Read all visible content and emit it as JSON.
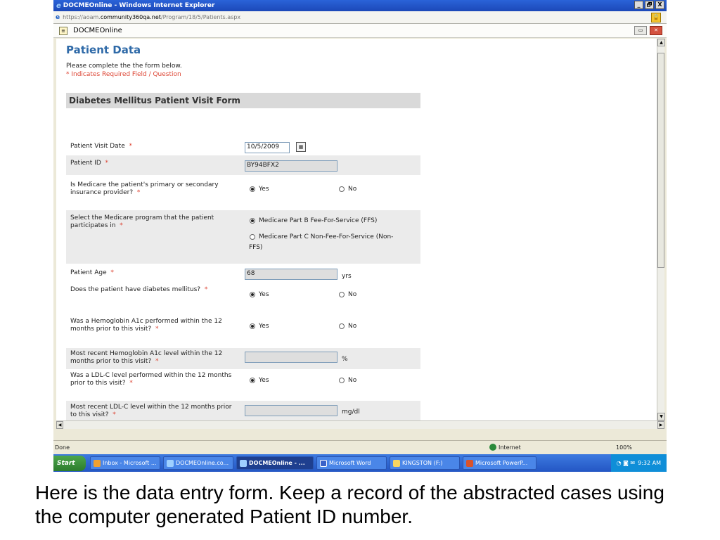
{
  "window": {
    "title": "DOCMEOnline - Windows Internet Explorer",
    "url_prefix": "https://",
    "url_host_sub": "aoam.",
    "url_host": "community360qa.net",
    "url_path": "/Program/18/5/Patients.aspx",
    "tab_title": "DOCMEOnline",
    "controls": {
      "minimize": "_",
      "maximize": "🗗",
      "close": "X"
    }
  },
  "page": {
    "title": "Patient Data",
    "intro_line": "Please complete the the form below.",
    "required_note": "* Indicates Required Field / Question",
    "form_title": "Diabetes Mellitus Patient Visit Form"
  },
  "form": {
    "visit_date": {
      "label": "Patient Visit Date",
      "value": "10/5/2009"
    },
    "patient_id": {
      "label": "Patient ID",
      "value": "BY94BFX2"
    },
    "medicare": {
      "label": "Is Medicare the patient's primary or secondary insurance provider?",
      "yes": "Yes",
      "no": "No"
    },
    "program": {
      "label": "Select the Medicare program that the patient participates in",
      "opt1": "Medicare Part B Fee-For-Service (FFS)",
      "opt2": "Medicare Part C Non-Fee-For-Service (Non-FFS)"
    },
    "age": {
      "label": "Patient Age",
      "value": "68",
      "unit": "yrs"
    },
    "diabetes": {
      "label": "Does the patient have diabetes mellitus?",
      "yes": "Yes",
      "no": "No"
    },
    "a1c_performed": {
      "label": "Was a Hemoglobin A1c performed within the 12 months prior to this visit?",
      "yes": "Yes",
      "no": "No"
    },
    "a1c_level": {
      "label": "Most recent Hemoglobin A1c level within the 12 months prior to this visit?",
      "value": "",
      "unit": "%"
    },
    "ldl_performed": {
      "label": "Was a LDL-C level performed within the 12 months prior to this visit?",
      "yes": "Yes",
      "no": "No"
    },
    "ldl_level": {
      "label": "Most recent LDL-C level within the 12 months prior to this visit?",
      "value": "",
      "unit": "mg/dl"
    },
    "required_mark": "*"
  },
  "status": {
    "text": "Done",
    "zone": "Internet",
    "zoom": "100%"
  },
  "taskbar": {
    "start": "Start",
    "items": [
      "Inbox - Microsoft ...",
      "DOCMEOnline.co...",
      "DOCMEOnline - ...",
      "Microsoft Word",
      "KINGSTON (F:)",
      "Microsoft PowerP..."
    ],
    "clock": "9:32 AM"
  },
  "caption": "Here is the data entry form.  Keep a record of the abstracted cases using the computer generated Patient ID number."
}
